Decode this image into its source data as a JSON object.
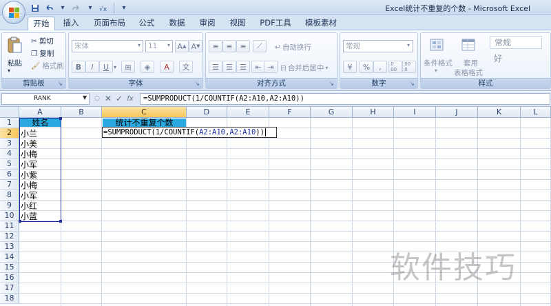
{
  "app": {
    "window_title": "Excel统计不重复的个数 - Microsoft Excel",
    "qat_icons": [
      "save-icon",
      "undo-icon",
      "redo-icon",
      "customize-icon"
    ],
    "colors": {
      "header_fill": "#29a9e0",
      "selection_border": "#1e2f9a",
      "selected_header": "#f6c659"
    }
  },
  "tabs": [
    {
      "label": "开始",
      "active": true
    },
    {
      "label": "插入"
    },
    {
      "label": "页面布局"
    },
    {
      "label": "公式"
    },
    {
      "label": "数据"
    },
    {
      "label": "审阅"
    },
    {
      "label": "视图"
    },
    {
      "label": "PDF工具"
    },
    {
      "label": "模板素材"
    }
  ],
  "ribbon": {
    "clipboard": {
      "label": "剪贴板",
      "paste": "粘贴",
      "cut": "剪切",
      "copy": "复制",
      "format_painter": "格式刷"
    },
    "font": {
      "label": "字体",
      "font_name": "宋体",
      "font_size": "11",
      "bold": "B",
      "italic": "I",
      "underline": "U"
    },
    "alignment": {
      "label": "对齐方式",
      "wrap_text": "自动换行",
      "merge_center": "合并后居中"
    },
    "number": {
      "label": "数字",
      "format": "常规",
      "percent": "%",
      "comma": ",",
      "inc_decimal": ".0 .00",
      "dec_decimal": ".00 .0"
    },
    "styles": {
      "label": "样式",
      "conditional_format": "条件格式",
      "table_format_line1": "套用",
      "table_format_line2": "表格格式",
      "normal": "常规",
      "good": "好"
    }
  },
  "formula_bar": {
    "name_box": "RANK",
    "cancel": "✕",
    "enter": "✓",
    "fx": "fx",
    "formula": "=SUMPRODUCT(1/COUNTIF(A2:A10,A2:A10))"
  },
  "sheet": {
    "columns": [
      "A",
      "B",
      "C",
      "D",
      "E",
      "F",
      "G",
      "H",
      "I",
      "J",
      "K",
      "L"
    ],
    "rows": [
      "1",
      "2",
      "3",
      "4",
      "5",
      "6",
      "7",
      "8",
      "9",
      "10",
      "11",
      "12",
      "13",
      "14",
      "15",
      "16",
      "17",
      "18"
    ],
    "a1_header": "姓名",
    "c1_header": "统计不重复个数",
    "names": [
      "小兰",
      "小美",
      "小梅",
      "小军",
      "小紫",
      "小梅",
      "小军",
      "小红",
      "小蓝"
    ],
    "editing": {
      "part1": "=SUMPRODUCT(1/COUNTIF(",
      "ref1": "A2:A10",
      "sep": ",",
      "ref2": "A2:A10",
      "part2": "))"
    }
  },
  "watermark": "软件技巧"
}
